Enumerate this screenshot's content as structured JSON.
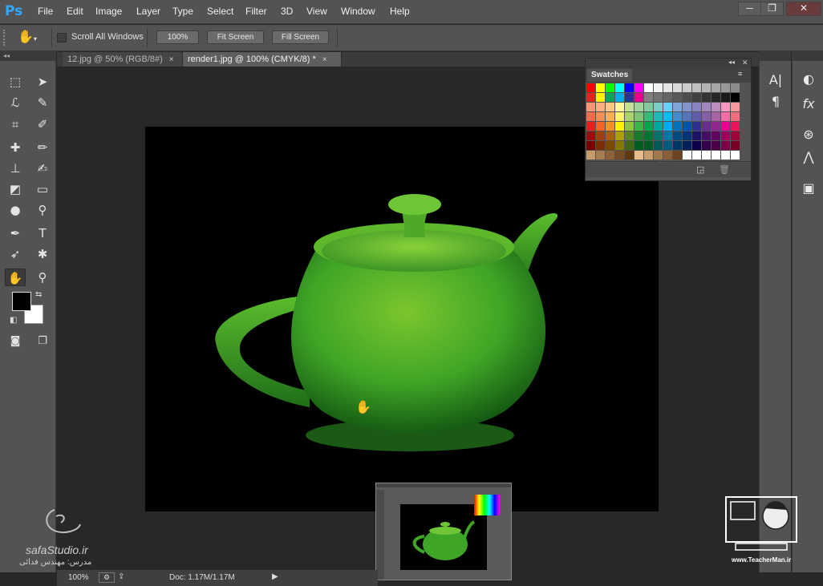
{
  "app": {
    "logo": "Ps"
  },
  "menu": [
    "File",
    "Edit",
    "Image",
    "Layer",
    "Type",
    "Select",
    "Filter",
    "3D",
    "View",
    "Window",
    "Help"
  ],
  "window_controls": {
    "minimize": "─",
    "restore": "❐",
    "close": "✕"
  },
  "options": {
    "tool_icon": "hand-icon",
    "scroll_all_label": "Scroll All Windows",
    "scroll_all_checked": false,
    "btn_100": "100%",
    "btn_fit": "Fit Screen",
    "btn_fill": "Fill Screen"
  },
  "tabs": [
    {
      "label": "12.jpg @ 50% (RGB/8#)",
      "close": "×",
      "active": false
    },
    {
      "label": "render1.jpg @ 100% (CMYK/8) *",
      "close": "×",
      "active": true
    }
  ],
  "toolbar": {
    "tools": [
      "rect-marquee",
      "move",
      "lasso",
      "quick-select",
      "crop",
      "eyedropper",
      "spot-heal",
      "brush",
      "clone-stamp",
      "history-brush",
      "eraser",
      "gradient",
      "blur",
      "dodge",
      "pen",
      "type",
      "path-select",
      "shape",
      "hand",
      "zoom"
    ],
    "fg_color": "#000000",
    "bg_color": "#ffffff"
  },
  "swatches": {
    "title": "Swatches",
    "rows": [
      [
        "#ff0000",
        "#ffff00",
        "#00ff00",
        "#00ffff",
        "#0000ff",
        "#ff00ff",
        "#ffffff",
        "#f2f2f2",
        "#e6e6e6",
        "#d9d9d9",
        "#cccccc",
        "#bfbfbf",
        "#b3b3b3",
        "#a6a6a6",
        "#999999",
        "#8c8c8c"
      ],
      [
        "#ee1d24",
        "#fff200",
        "#00a651",
        "#00aeef",
        "#2e3192",
        "#ec008c",
        "#808080",
        "#737373",
        "#666666",
        "#595959",
        "#4d4d4d",
        "#404040",
        "#333333",
        "#262626",
        "#1a1a1a",
        "#000000"
      ],
      [
        "#f7977a",
        "#f9ad81",
        "#fdc68a",
        "#fff79a",
        "#c4df9b",
        "#a3d39c",
        "#82ca9d",
        "#7bcdc8",
        "#6ecff6",
        "#7ea7d8",
        "#8493ca",
        "#8882be",
        "#a187be",
        "#bc8dbf",
        "#f49ac2",
        "#f6989d"
      ],
      [
        "#f26c4f",
        "#f68e55",
        "#fbaf5c",
        "#fff467",
        "#acd372",
        "#7cc576",
        "#3bb878",
        "#1abbb4",
        "#00bff3",
        "#438cca",
        "#5574b9",
        "#605ca8",
        "#855fa8",
        "#a763a8",
        "#f06ea9",
        "#f26d7d"
      ],
      [
        "#ed1c24",
        "#f26522",
        "#f7941d",
        "#fff200",
        "#8dc73f",
        "#39b54a",
        "#00a651",
        "#00a99d",
        "#00aeef",
        "#0072bc",
        "#0054a6",
        "#2e3192",
        "#662d91",
        "#92278f",
        "#ec008c",
        "#ed145b"
      ],
      [
        "#9e0b0f",
        "#a0410d",
        "#a3620a",
        "#aba000",
        "#598527",
        "#197b30",
        "#007236",
        "#00746b",
        "#0076a3",
        "#004b80",
        "#003471",
        "#1b1464",
        "#440e62",
        "#630460",
        "#9e005d",
        "#9e0039"
      ],
      [
        "#790000",
        "#7b2e00",
        "#7d4900",
        "#827b00",
        "#406618",
        "#005e20",
        "#005826",
        "#005952",
        "#005b7f",
        "#003663",
        "#002157",
        "#0d004c",
        "#32004b",
        "#4b0049",
        "#7b0046",
        "#7a0026"
      ],
      [
        "#c69c6d",
        "#a67c52",
        "#8c6239",
        "#754c24",
        "#603913",
        "#e6bc8a",
        "#c59d6e",
        "#a1794f",
        "#8a5f38",
        "#6e4420",
        "#ffffff",
        "#ffffff",
        "#ffffff",
        "#ffffff",
        "#ffffff",
        "#ffffff"
      ]
    ]
  },
  "dock1_icons": [
    "character-icon",
    "paragraph-icon"
  ],
  "dock2_icons": [
    "adjustments-icon",
    "styles-icon",
    "channels-icon",
    "paths-icon",
    "layers-3d-icon"
  ],
  "status": {
    "zoom": "100%",
    "doc": "Doc: 1.17M/1.17M"
  },
  "watermarks": {
    "left_site": "safaStudio.ir",
    "left_author": "مدرس: مهندس فدائی",
    "right_site": "www.TeacherMan.ir"
  }
}
